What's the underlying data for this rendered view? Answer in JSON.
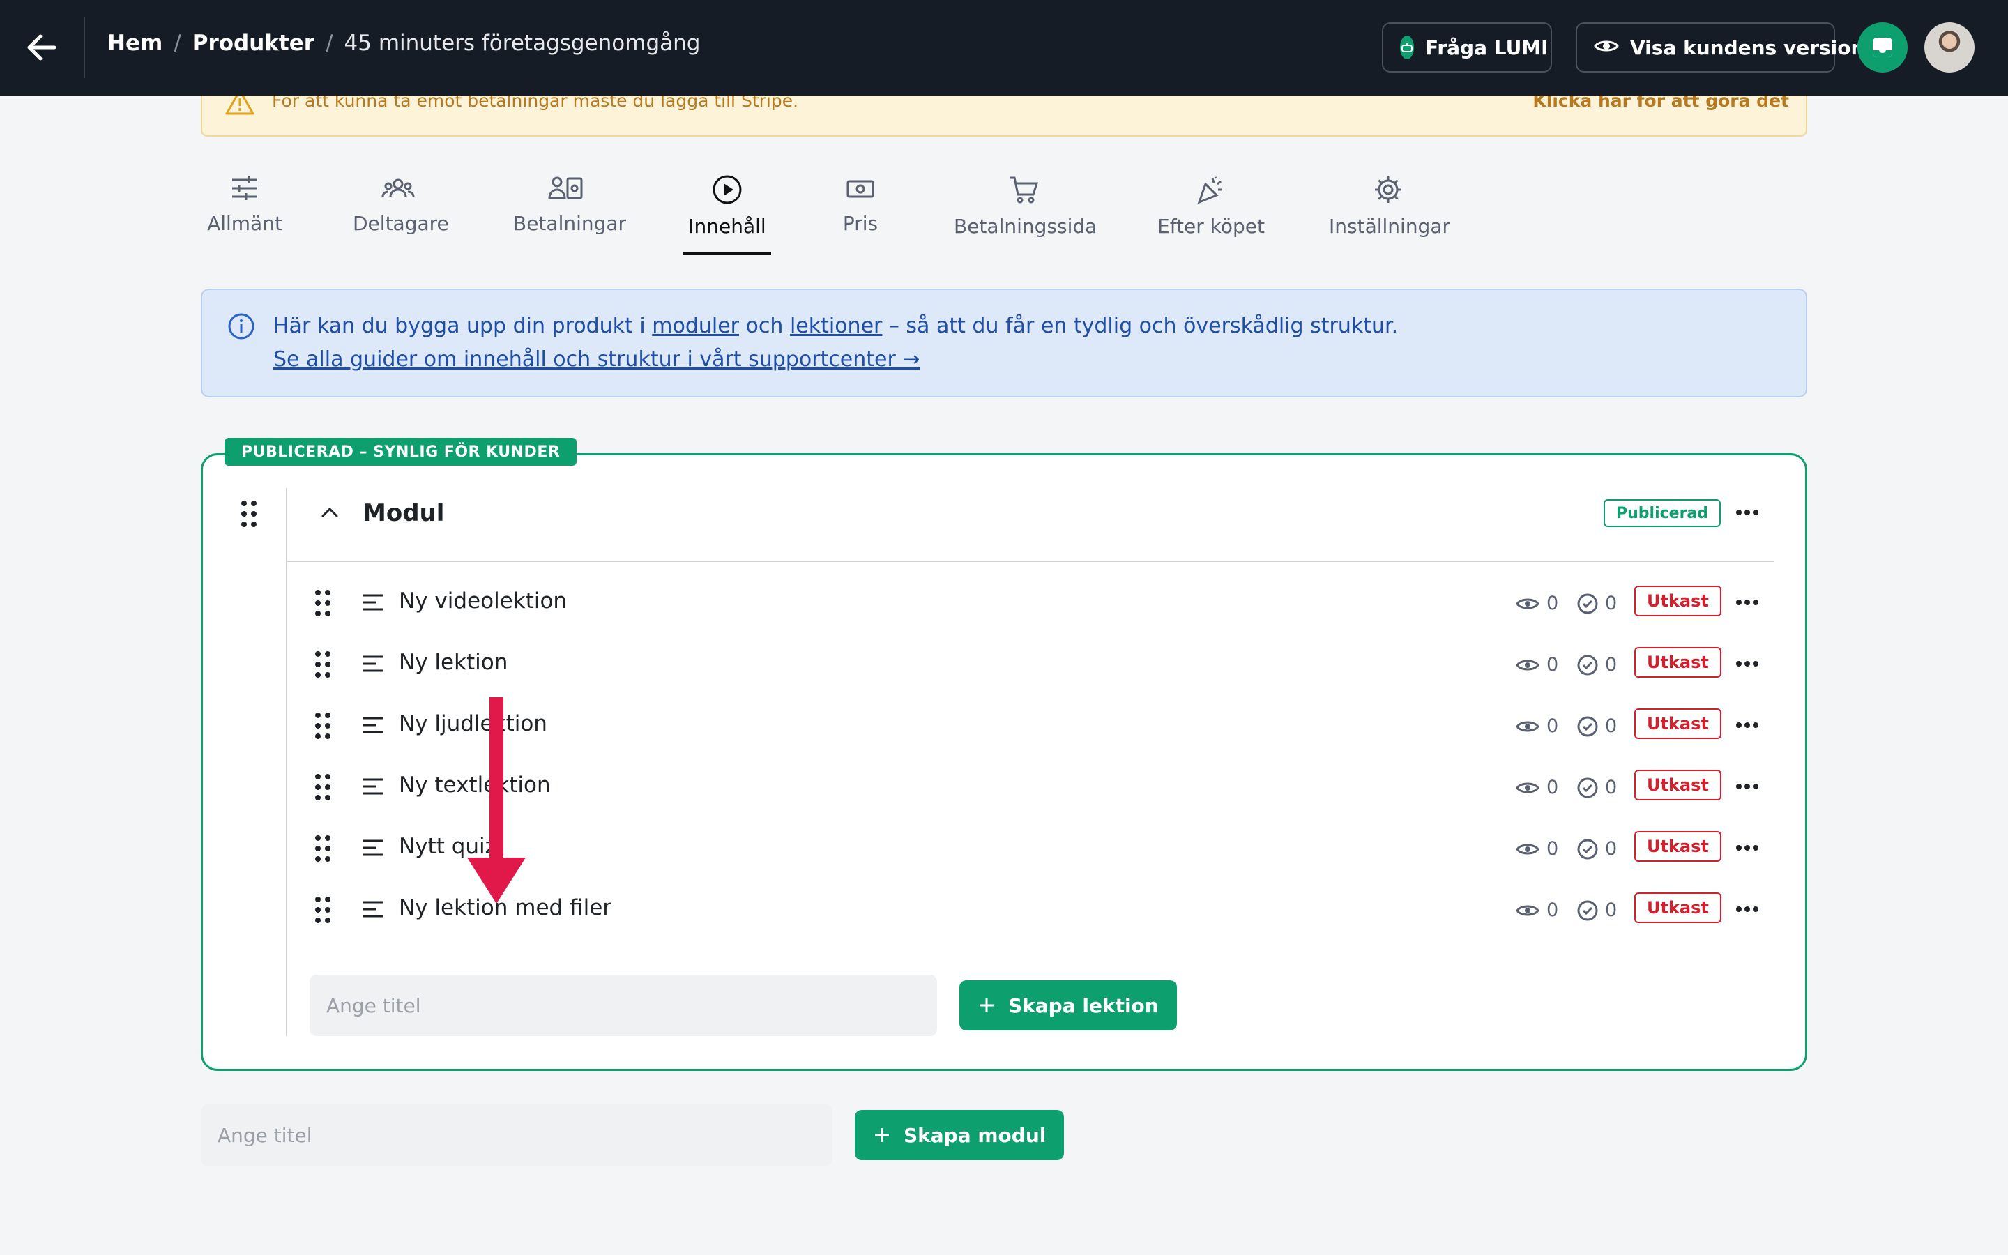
{
  "header": {
    "breadcrumbs": [
      "Hem",
      "Produkter",
      "45 minuters företagsgenomgång"
    ],
    "separator": "/",
    "ask_lumi": "Fråga LUMI",
    "customer_view": "Visa kundens version"
  },
  "warning": {
    "text": "För att kunna ta emot betalningar måste du lägga till Stripe.",
    "action": "Klicka här för att göra det"
  },
  "tabs": [
    {
      "label": "Allmänt",
      "icon": "sliders-icon"
    },
    {
      "label": "Deltagare",
      "icon": "users-icon"
    },
    {
      "label": "Betalningar",
      "icon": "payments-icon"
    },
    {
      "label": "Innehåll",
      "icon": "play-circle-icon",
      "active": true
    },
    {
      "label": "Pris",
      "icon": "banknote-icon"
    },
    {
      "label": "Betalningssida",
      "icon": "cart-icon"
    },
    {
      "label": "Efter köpet",
      "icon": "party-icon"
    },
    {
      "label": "Inställningar",
      "icon": "gear-icon"
    }
  ],
  "info": {
    "prefix": "Här kan du bygga upp din produkt i ",
    "link1": "moduler",
    "mid": " och ",
    "link2": "lektioner",
    "suffix": " – så att du får en tydlig och överskådlig struktur.",
    "guide_link": "Se alla guider om innehåll och struktur i vårt supportcenter →"
  },
  "module": {
    "status_tag": "PUBLICERAD – SYNLIG FÖR KUNDER",
    "title": "Modul",
    "badge": "Publicerad",
    "lessons": [
      {
        "title": "Ny videolektion",
        "views": "0",
        "completed": "0",
        "status": "Utkast"
      },
      {
        "title": "Ny lektion",
        "views": "0",
        "completed": "0",
        "status": "Utkast"
      },
      {
        "title": "Ny ljudlektion",
        "views": "0",
        "completed": "0",
        "status": "Utkast"
      },
      {
        "title": "Ny textlektion",
        "views": "0",
        "completed": "0",
        "status": "Utkast"
      },
      {
        "title": "Nytt quiz",
        "views": "0",
        "completed": "0",
        "status": "Utkast"
      },
      {
        "title": "Ny lektion med filer",
        "views": "0",
        "completed": "0",
        "status": "Utkast"
      }
    ],
    "lesson_input_placeholder": "Ange titel",
    "create_lesson": "Skapa lektion"
  },
  "new_module": {
    "input_placeholder": "Ange titel",
    "create_module": "Skapa modul"
  },
  "colors": {
    "accent": "#0e9f6e",
    "draft": "#d61f2c",
    "annotation_arrow": "#e0194a"
  }
}
